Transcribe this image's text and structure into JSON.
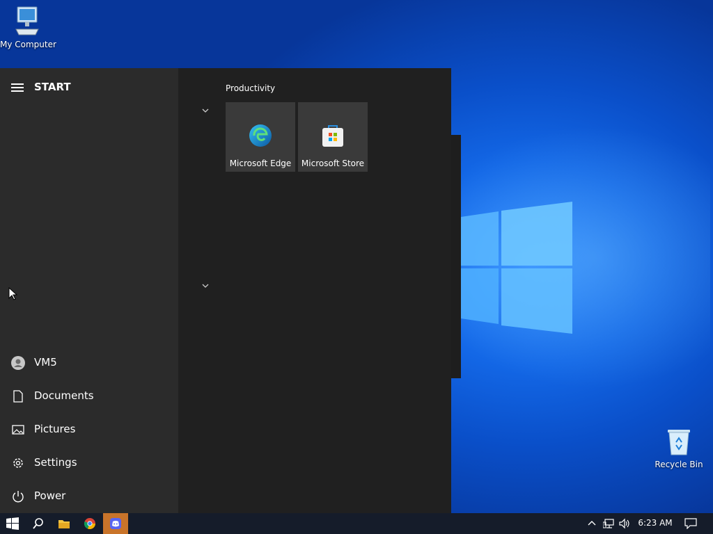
{
  "desktop": {
    "icons": [
      {
        "label": "My Computer",
        "icon": "computer-icon"
      },
      {
        "label": "Recycle Bin",
        "icon": "recycle-bin-icon"
      }
    ]
  },
  "start_menu": {
    "title": "START",
    "nav_items": [
      {
        "label": "VM5",
        "icon": "user-icon"
      },
      {
        "label": "Documents",
        "icon": "document-icon"
      },
      {
        "label": "Pictures",
        "icon": "picture-icon"
      },
      {
        "label": "Settings",
        "icon": "gear-icon"
      },
      {
        "label": "Power",
        "icon": "power-icon"
      }
    ],
    "group": {
      "title": "Productivity",
      "tiles": [
        {
          "label": "Microsoft Edge",
          "icon": "edge-icon"
        },
        {
          "label": "Microsoft Store",
          "icon": "store-icon"
        }
      ]
    }
  },
  "taskbar": {
    "buttons": [
      "windows-start-icon",
      "search-icon",
      "file-explorer-icon",
      "chrome-icon",
      "discord-icon"
    ],
    "tray_icons": [
      "chevron-up-icon",
      "network-icon",
      "volume-icon",
      "notification-icon"
    ],
    "time": "6:23 AM"
  },
  "colors": {
    "desktop_blue": "#0a4fc9",
    "menu_bg": "#202020",
    "pane_bg": "#2b2b2b",
    "tile_bg": "#3a3a3a",
    "taskbar_bg": "#151c2a",
    "discord_active": "#c9742a"
  }
}
